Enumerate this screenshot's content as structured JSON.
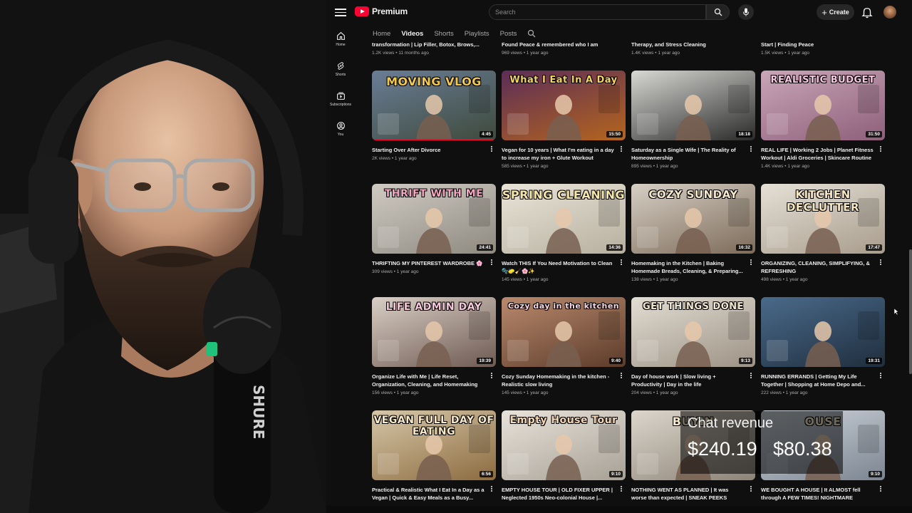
{
  "header": {
    "logo_text": "Premium",
    "search_placeholder": "Search",
    "create_label": "Create"
  },
  "siderail": [
    {
      "label": "Home",
      "icon": "home-icon"
    },
    {
      "label": "Shorts",
      "icon": "shorts-icon"
    },
    {
      "label": "Subscriptions",
      "icon": "subscriptions-icon"
    },
    {
      "label": "You",
      "icon": "you-icon"
    }
  ],
  "channel_tabs": [
    {
      "label": "Home",
      "active": false
    },
    {
      "label": "Videos",
      "active": true
    },
    {
      "label": "Shorts",
      "active": false
    },
    {
      "label": "Playlists",
      "active": false
    },
    {
      "label": "Posts",
      "active": false
    }
  ],
  "partial_row": [
    {
      "title": "transformation | Lip Filler, Botox, Brows,...",
      "meta": "1.2K views • 11 months ago"
    },
    {
      "title": "Found Peace & remembered who I am",
      "meta": "969 views • 1 year ago"
    },
    {
      "title": "Therapy, and Stress Cleaning",
      "meta": "1.4K views • 1 year ago"
    },
    {
      "title": "Start | Finding Peace",
      "meta": "1.5K views • 1 year ago"
    }
  ],
  "videos": [
    {
      "thumb_text": "MOVING VLOG",
      "thumb_color": "#f2c94c",
      "bg": [
        "#6a7d96",
        "#3e4a3c"
      ],
      "duration": "4:45",
      "progress": 1.0,
      "title": "Starting Over After Divorce",
      "meta": "2K views • 1 year ago"
    },
    {
      "thumb_text": "What I Eat In A Day",
      "thumb_color": "#f4d35e",
      "bg": [
        "#5b2d58",
        "#b5651d"
      ],
      "duration": "15:50",
      "progress": 0,
      "title": "Vegan for 10 years | What I'm eating in a day to increase my iron + Glute Workout",
      "meta": "585 views • 1 year ago"
    },
    {
      "thumb_text": "",
      "thumb_color": "#ffffff",
      "bg": [
        "#d8d8d4",
        "#2a2a2a"
      ],
      "duration": "18:18",
      "progress": 0,
      "title": "Saturday as a Single Wife | The Reality of Homeownership",
      "meta": "895 views • 1 year ago"
    },
    {
      "thumb_text": "REALISTIC BUDGET",
      "thumb_color": "#f7c6e0",
      "bg": [
        "#c9a6b8",
        "#8e5f7a"
      ],
      "duration": "31:50",
      "progress": 0,
      "title": "REAL LIFE | Working 2 Jobs | Planet Fitness Workout | Aldi Groceries | Skincare Routine",
      "meta": "1.4K views • 1 year ago"
    },
    {
      "thumb_text": "THRIFT WITH ME",
      "thumb_color": "#f4a7c0",
      "bg": [
        "#cfcac3",
        "#8f8a80"
      ],
      "duration": "24:41",
      "progress": 0,
      "title": "THRIFTING MY PINTEREST WARDROBE 🌸",
      "meta": "309 views • 1 year ago"
    },
    {
      "thumb_text": "SPRING CLEANING",
      "thumb_color": "#f5e6a8",
      "bg": [
        "#e9e4d8",
        "#b7b0a0"
      ],
      "duration": "14:36",
      "progress": 0,
      "title": "Watch THIS If You Need Motivation to Clean 🫧🧽🧹🌸✨",
      "meta": "145 views • 1 year ago"
    },
    {
      "thumb_text": "COZY SUNDAY",
      "thumb_color": "#f3e6c8",
      "bg": [
        "#d6cfc4",
        "#7d6b5a"
      ],
      "duration": "16:32",
      "progress": 0,
      "title": "Homemaking in the Kitchen | Baking Homemade Breads, Cleaning, & Preparing...",
      "meta": "138 views • 1 year ago"
    },
    {
      "thumb_text": "KITCHEN DECLUTTER",
      "thumb_color": "#f6e7c1",
      "bg": [
        "#e5e0d6",
        "#a89c8c"
      ],
      "duration": "17:47",
      "progress": 0,
      "title": "ORGANIZING, CLEANING, SIMPLIFYING, & REFRESHING",
      "meta": "498 views • 1 year ago"
    },
    {
      "thumb_text": "LIFE ADMIN DAY",
      "thumb_color": "#f6c7d9",
      "bg": [
        "#d9cfc6",
        "#6e5a52"
      ],
      "duration": "19:39",
      "progress": 0,
      "title": "Organize Life with Me | Life Reset, Organization, Cleaning, and Homemaking",
      "meta": "156 views • 1 year ago"
    },
    {
      "thumb_text": "Cozy day in the kitchen",
      "thumb_color": "#f6d6e4",
      "bg": [
        "#b98a6d",
        "#5c3b2a"
      ],
      "duration": "9:40",
      "progress": 0,
      "title": "Cozy Sunday Homemaking in the kitchen - Realistic slow living",
      "meta": "145 views • 1 year ago"
    },
    {
      "thumb_text": "GET THINGS DONE",
      "thumb_color": "#f3e9d2",
      "bg": [
        "#e2ddd3",
        "#9d9285"
      ],
      "duration": "9:13",
      "progress": 0,
      "title": "Day of house work | Slow living + Productivity | Day in the life",
      "meta": "204 views • 1 year ago"
    },
    {
      "thumb_text": "",
      "thumb_color": "#ffffff",
      "bg": [
        "#4a6a8a",
        "#1f2e3e"
      ],
      "duration": "19:31",
      "progress": 0,
      "title": "RUNNING ERRANDS | Getting My Life Together | Shopping at Home Depo and...",
      "meta": "222 views • 1 year ago"
    },
    {
      "thumb_text": "VEGAN FULL DAY OF EATING",
      "thumb_color": "#f6e9c8",
      "bg": [
        "#d6c7a8",
        "#8c6b3f"
      ],
      "duration": "6:56",
      "progress": 0,
      "title": "Practical & Realistic What I Eat In a Day as a Vegan | Quick & Easy Meals as a Busy...",
      "meta": ""
    },
    {
      "thumb_text": "Empty House Tour",
      "thumb_color": "#f4d7b5",
      "bg": [
        "#e8e3da",
        "#a7a095"
      ],
      "duration": "9:10",
      "progress": 0,
      "title": "EMPTY HOUSE TOUR | OLD FIXER UPPER | Neglected 1950s Neo-colonial House |...",
      "meta": ""
    },
    {
      "thumb_text": "BUYIN",
      "thumb_color": "#f6e9c8",
      "bg": [
        "#dcd6cc",
        "#8d8478"
      ],
      "duration": "",
      "progress": 0,
      "title": "NOTHING WENT AS PLANNED | It was worse than expected | SNEAK PEEKS",
      "meta": ""
    },
    {
      "thumb_text": "OUSE",
      "thumb_color": "#f6e9c8",
      "bg": [
        "#cfd5dc",
        "#7b8591"
      ],
      "duration": "9:10",
      "progress": 0,
      "title": "WE BOUGHT A HOUSE | It ALMOST fell through A FEW TIMES! NIGHTMARE LENDER | So...",
      "meta": ""
    }
  ],
  "overlay": {
    "title": "Chat revenue",
    "value_1": "$240.19",
    "value_2": "$80.38"
  },
  "webcam": {
    "mic_brand": "SHURE"
  }
}
